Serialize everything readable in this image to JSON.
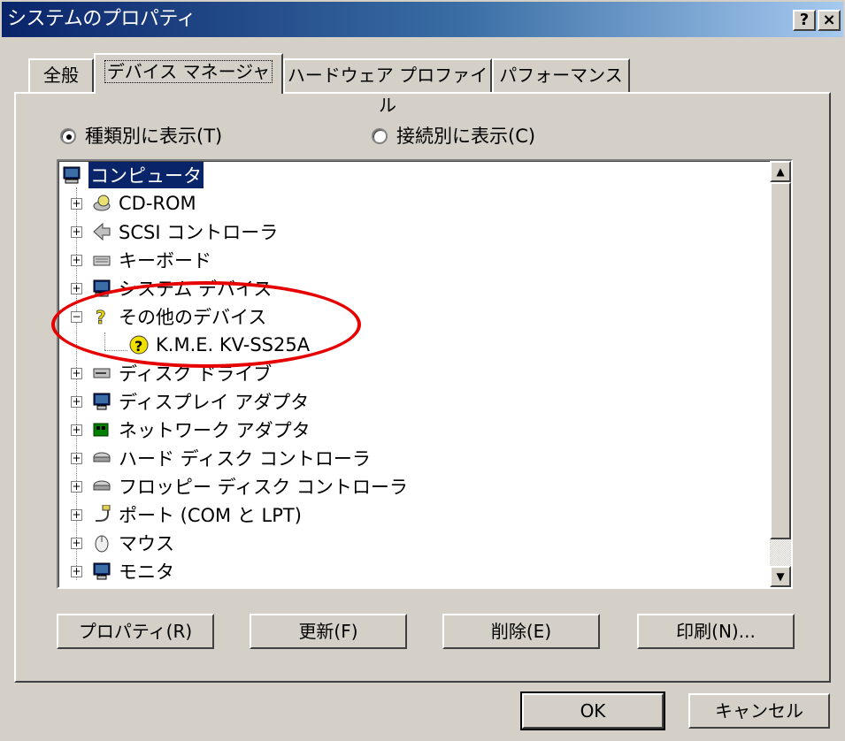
{
  "window": {
    "title": "システムのプロパティ",
    "help_btn": "?",
    "close_btn": "×"
  },
  "tabs": [
    {
      "label": "全般"
    },
    {
      "label": "デバイス マネージャ",
      "active": true
    },
    {
      "label": "ハードウェア プロファイル"
    },
    {
      "label": "パフォーマンス"
    }
  ],
  "view_options": {
    "by_type": "種類別に表示(T)",
    "by_connection": "接続別に表示(C)",
    "selected": "by_type"
  },
  "tree": {
    "root": "コンピュータ",
    "items": [
      {
        "label": "CD-ROM",
        "icon": "cdrom-icon",
        "expander": "+"
      },
      {
        "label": "SCSI コントローラ",
        "icon": "scsi-icon",
        "expander": "+"
      },
      {
        "label": "キーボード",
        "icon": "keyboard-icon",
        "expander": "+"
      },
      {
        "label": "システム デバイス",
        "icon": "computer-icon",
        "expander": "+"
      },
      {
        "label": "その他のデバイス",
        "icon": "question-icon",
        "expander": "−"
      },
      {
        "label": "K.M.E. KV-SS25A",
        "icon": "unknown-device-icon",
        "child": true
      },
      {
        "label": "ディスク ドライブ",
        "icon": "disk-drive-icon",
        "expander": "+"
      },
      {
        "label": "ディスプレイ アダプタ",
        "icon": "display-adapter-icon",
        "expander": "+"
      },
      {
        "label": "ネットワーク アダプタ",
        "icon": "network-adapter-icon",
        "expander": "+"
      },
      {
        "label": "ハード ディスク コントローラ",
        "icon": "hdd-controller-icon",
        "expander": "+"
      },
      {
        "label": "フロッピー ディスク コントローラ",
        "icon": "fdd-controller-icon",
        "expander": "+"
      },
      {
        "label": "ポート (COM と LPT)",
        "icon": "port-icon",
        "expander": "+"
      },
      {
        "label": "マウス",
        "icon": "mouse-icon",
        "expander": "+"
      },
      {
        "label": "モニタ",
        "icon": "monitor-icon",
        "expander": "+"
      }
    ]
  },
  "scroll": {
    "up": "▲",
    "down": "▼"
  },
  "actions": {
    "properties": "プロパティ(R)",
    "refresh": "更新(F)",
    "remove": "削除(E)",
    "print": "印刷(N)..."
  },
  "dialog_buttons": {
    "ok": "OK",
    "cancel": "キャンセル"
  },
  "colors": {
    "selection": "#0a246a",
    "annotation": "#e60000"
  }
}
